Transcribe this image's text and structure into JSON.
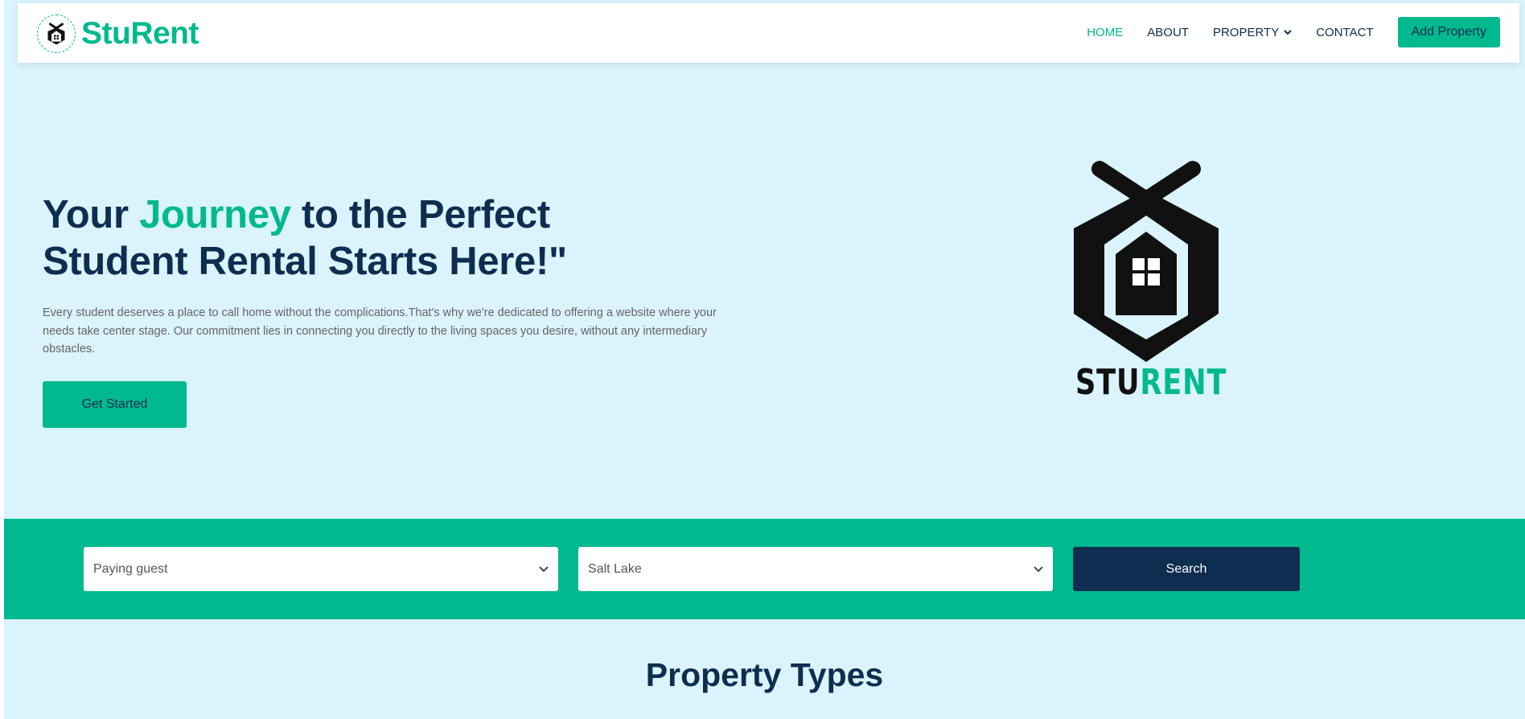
{
  "brand": {
    "name": "StuRent",
    "logo_icon": "house-hexagon-icon"
  },
  "nav": {
    "items": [
      {
        "label": "HOME",
        "active": true
      },
      {
        "label": "ABOUT",
        "active": false
      },
      {
        "label": "PROPERTY",
        "active": false,
        "dropdown": true
      },
      {
        "label": "CONTACT",
        "active": false
      }
    ],
    "add_property_label": "Add Property"
  },
  "hero": {
    "title_part1": "Your ",
    "title_accent": "Journey",
    "title_part2": " to the Perfect Student Rental Starts Here!\"",
    "description": "Every student deserves a place to call home without the complications.That's why we're dedicated to offering a website where your needs take center stage. Our commitment lies in connecting you directly to the living spaces you desire, without any intermediary obstacles.",
    "cta_label": "Get Started",
    "logo_word_dark": "STU",
    "logo_word_accent": "RENT"
  },
  "search": {
    "type_value": "Paying guest",
    "location_value": "Salt Lake",
    "button_label": "Search"
  },
  "sections": {
    "property_types_title": "Property Types"
  },
  "colors": {
    "primary": "#00b98e",
    "dark": "#0e2e50",
    "background": "#daf3fd"
  }
}
